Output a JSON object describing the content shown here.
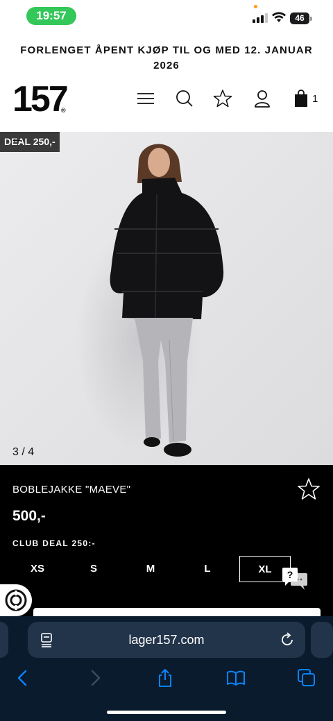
{
  "status_bar": {
    "time": "19:57",
    "battery": "46",
    "battery_level_percent": 46
  },
  "announcement": {
    "text": "FORLENGET ÅPENT KJØP TIL OG MED 12. JANUAR 2026"
  },
  "header": {
    "logo_text": "157",
    "logo_reg": "®",
    "cart_count": "1",
    "icons": [
      "menu-icon",
      "search-icon",
      "star-icon",
      "user-icon",
      "shopping-bag-icon"
    ]
  },
  "gallery": {
    "deal_badge": "DEAL 250,-",
    "counter": "3 / 4"
  },
  "product": {
    "name": "BOBLEJAKKE \"MAEVE\"",
    "price": "500,-",
    "club_deal": "CLUB DEAL 250:-",
    "sizes": [
      "XS",
      "S",
      "M",
      "L",
      "XL"
    ],
    "selected_size": "XL"
  },
  "browser": {
    "url": "lager157.com"
  },
  "colors": {
    "status_green": "#34c759",
    "panel_black": "#000000",
    "browser_bg": "#0a1b2e",
    "accent_blue": "#0a84ff"
  }
}
